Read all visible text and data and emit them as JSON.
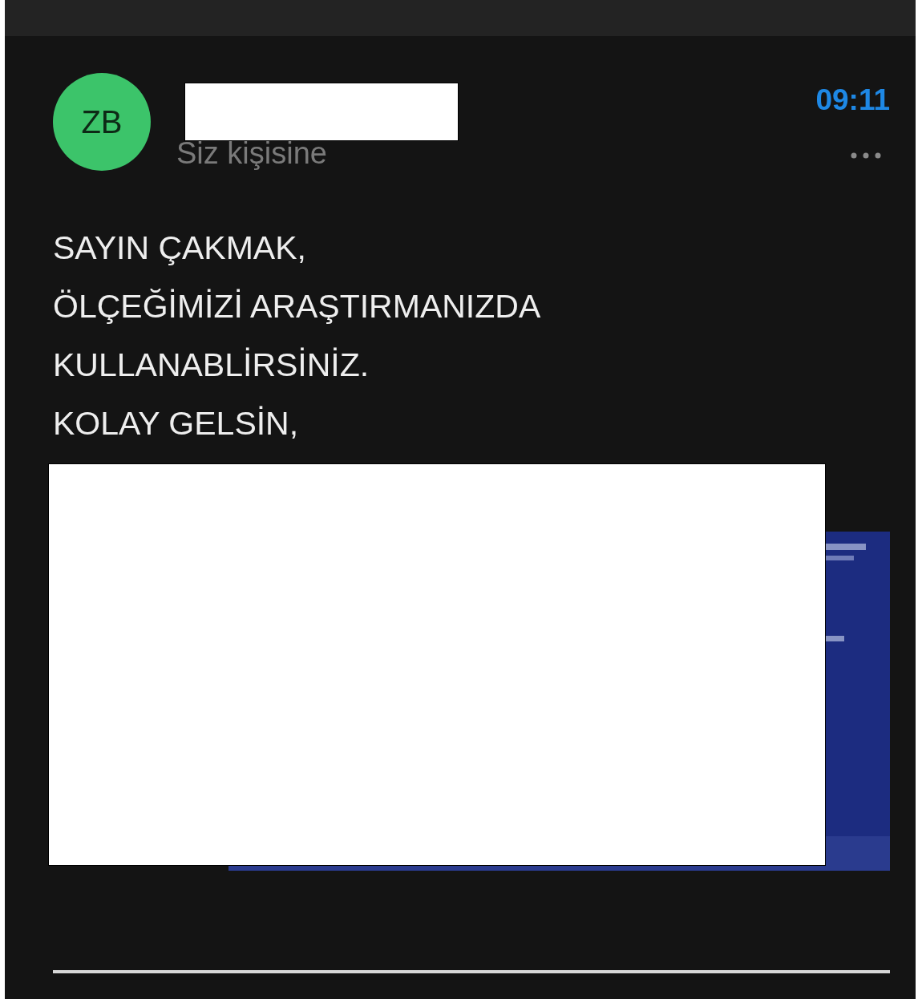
{
  "message": {
    "avatar_initials": "ZB",
    "recipient": "Siz kişisine",
    "time": "09:11"
  },
  "body": {
    "lines": [
      "SAYIN ÇAKMAK,",
      "ÖLÇEĞİMİZİ ARAŞTIRMANIZDA",
      "KULLANABLİRSİNİZ.",
      "KOLAY GELSİN,"
    ]
  }
}
